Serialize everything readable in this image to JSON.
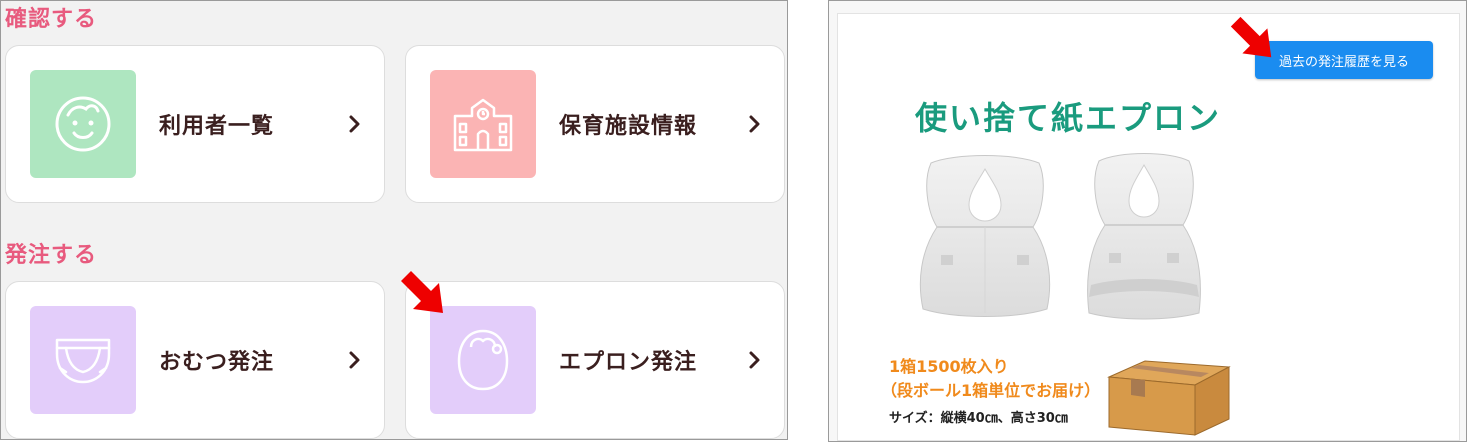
{
  "left": {
    "confirm_section": "確認する",
    "order_section": "発注する",
    "cards": {
      "users": {
        "label": "利用者一覧",
        "tile_color": "#aee6c0"
      },
      "facility": {
        "label": "保育施設情報",
        "tile_color": "#fbb4b4"
      },
      "diaper": {
        "label": "おむつ発注",
        "tile_color": "#e3cdfa"
      },
      "apron": {
        "label": "エプロン発注",
        "tile_color": "#e3cdfa"
      }
    }
  },
  "right": {
    "history_button": "過去の発注履歴を見る",
    "product_title": "使い捨て紙エプロン",
    "qty_line1": "1箱1500枚入り",
    "qty_line2": "（段ボール1箱単位でお届け）",
    "size_text": "サイズ：縦横40㎝、高さ30㎝"
  },
  "colors": {
    "accent_pink": "#e85a7e",
    "button_blue": "#1a8cf0",
    "title_green": "#1a9b7e",
    "info_orange": "#f08a1c",
    "highlight_arrow": "#ee0000"
  }
}
